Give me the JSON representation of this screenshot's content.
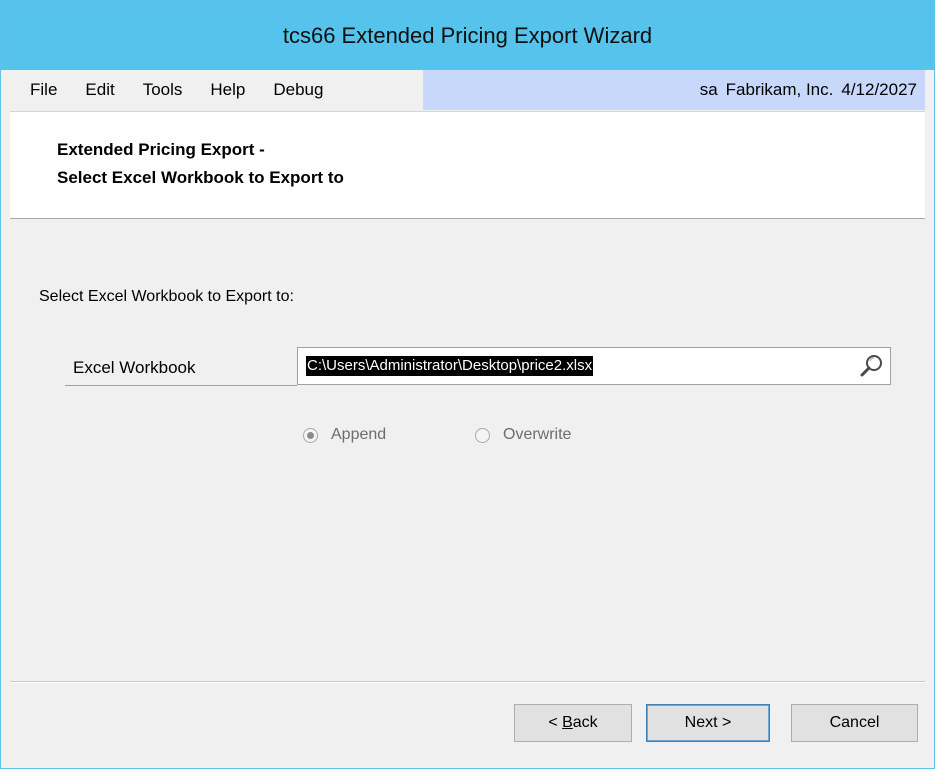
{
  "window": {
    "title": "tcs66 Extended Pricing Export Wizard"
  },
  "menu": {
    "items": [
      {
        "label": "File"
      },
      {
        "label": "Edit"
      },
      {
        "label": "Tools"
      },
      {
        "label": "Help"
      },
      {
        "label": "Debug"
      }
    ]
  },
  "status": {
    "user": "sa",
    "company": "Fabrikam, Inc.",
    "date": "4/12/2027"
  },
  "header": {
    "line1": "Extended Pricing Export -",
    "line2": "Select Excel Workbook to Export to"
  },
  "body": {
    "section_label": "Select Excel Workbook to Export to:",
    "workbook_label": "Excel Workbook",
    "workbook_value": "C:\\Users\\Administrator\\Desktop\\price2.xlsx",
    "options": [
      {
        "label": "Append",
        "checked": true
      },
      {
        "label": "Overwrite",
        "checked": false
      }
    ]
  },
  "buttons": {
    "back_prefix": "< ",
    "back_access_key": "B",
    "back_rest": "ack",
    "next": "Next >",
    "cancel": "Cancel"
  },
  "colors": {
    "titlebar": "#55c3ec",
    "status_area": "#c8d8fb",
    "selection": "#000000"
  },
  "icons": {
    "lookup": "magnifier-icon"
  }
}
